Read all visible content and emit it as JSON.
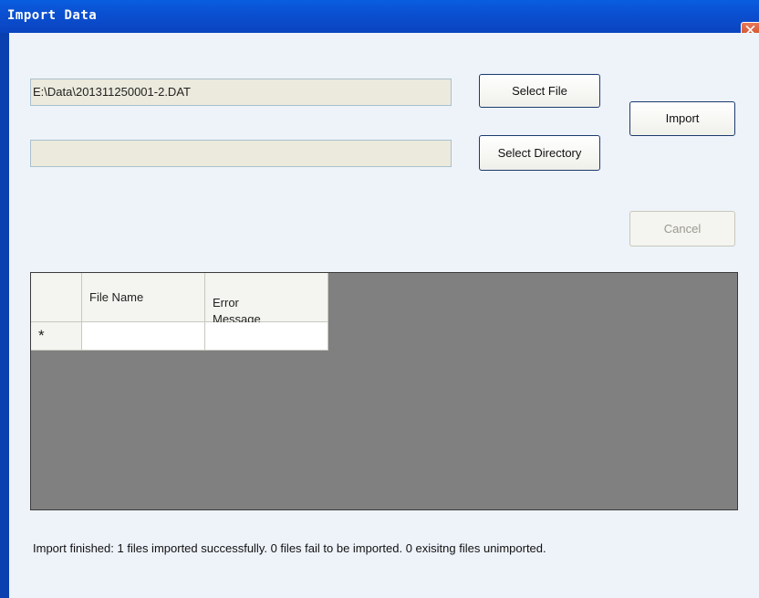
{
  "window": {
    "title": "Import Data"
  },
  "file_path": {
    "value": "E:\\Data\\201311250001-2.DAT"
  },
  "directory_path": {
    "value": ""
  },
  "buttons": {
    "select_file": "Select File",
    "select_directory": "Select Directory",
    "import": "Import",
    "cancel": "Cancel"
  },
  "grid": {
    "columns": [
      "File Name",
      "Error\nMessage"
    ],
    "new_row_marker": "*",
    "rows": []
  },
  "status": "Import finished: 1 files imported successfully. 0 files fail to be imported. 0 exisitng files unimported."
}
